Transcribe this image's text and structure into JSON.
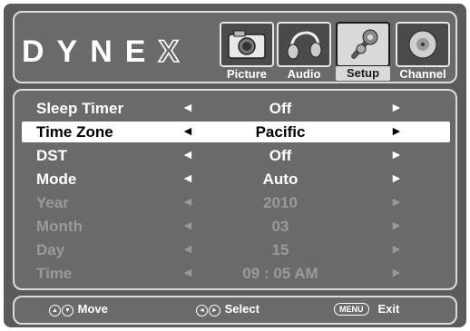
{
  "brand": {
    "logo_text": "DYNE",
    "logo_x": "X"
  },
  "tabs": [
    {
      "label": "Picture",
      "icon": "camera-icon"
    },
    {
      "label": "Audio",
      "icon": "headphones-icon"
    },
    {
      "label": "Setup",
      "icon": "wrench-icon",
      "active": true
    },
    {
      "label": "Channel",
      "icon": "satellite-dish-icon"
    }
  ],
  "menu": {
    "arrow_left": "◄",
    "arrow_right": "►",
    "rows": [
      {
        "label": "Sleep Timer",
        "value": "Off"
      },
      {
        "label": "Time Zone",
        "value": "Pacific",
        "selected": true
      },
      {
        "label": "DST",
        "value": "Off"
      },
      {
        "label": "Mode",
        "value": "Auto"
      },
      {
        "label": "Year",
        "value": "2010",
        "disabled": true
      },
      {
        "label": "Month",
        "value": "03",
        "disabled": true
      },
      {
        "label": "Day",
        "value": "15",
        "disabled": true
      },
      {
        "label": "Time",
        "value": "09 : 05  AM",
        "disabled": true
      }
    ]
  },
  "footer": {
    "move_label": "Move",
    "select_label": "Select",
    "menu_key": "MENU",
    "exit_label": "Exit"
  }
}
